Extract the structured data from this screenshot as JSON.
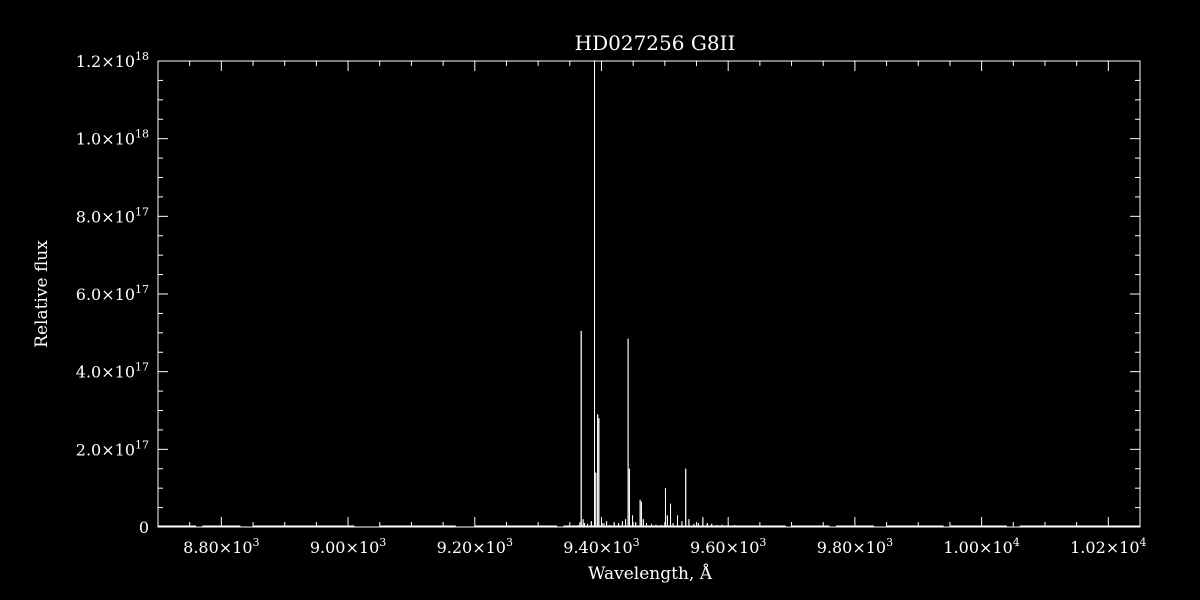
{
  "chart_data": {
    "type": "line",
    "title": "HD027256   G8II",
    "xlabel": "Wavelength, Å",
    "ylabel": "Relative flux",
    "xlim": [
      8700,
      10250
    ],
    "ylim": [
      0,
      1.2e+18
    ],
    "colors": {
      "background": "#000000",
      "foreground": "#ffffff"
    },
    "x_ticks": [
      {
        "value": 8800,
        "mant": "8.80",
        "exp": "3"
      },
      {
        "value": 9000,
        "mant": "9.00",
        "exp": "3"
      },
      {
        "value": 9200,
        "mant": "9.20",
        "exp": "3"
      },
      {
        "value": 9400,
        "mant": "9.40",
        "exp": "3"
      },
      {
        "value": 9600,
        "mant": "9.60",
        "exp": "3"
      },
      {
        "value": 9800,
        "mant": "9.80",
        "exp": "3"
      },
      {
        "value": 10000,
        "mant": "1.00",
        "exp": "4"
      },
      {
        "value": 10200,
        "mant": "1.02",
        "exp": "4"
      }
    ],
    "y_ticks": [
      {
        "value": 0,
        "mant": "0",
        "exp": ""
      },
      {
        "value": 2e+17,
        "mant": "2.0",
        "exp": "17"
      },
      {
        "value": 4e+17,
        "mant": "4.0",
        "exp": "17"
      },
      {
        "value": 6e+17,
        "mant": "6.0",
        "exp": "17"
      },
      {
        "value": 8e+17,
        "mant": "8.0",
        "exp": "17"
      },
      {
        "value": 1e+18,
        "mant": "1.0",
        "exp": "18"
      },
      {
        "value": 1.2e+18,
        "mant": "1.2",
        "exp": "18"
      }
    ],
    "times_symbol": "×10",
    "baseline_segments": [
      [
        8700,
        8760
      ],
      [
        8770,
        8830
      ],
      [
        8850,
        9010
      ],
      [
        9050,
        9170
      ],
      [
        9200,
        9330
      ],
      [
        9340,
        9370
      ]
    ],
    "series": [
      {
        "values": [
          [
            9350,
            2000000000000000.0
          ],
          [
            9355,
            4000000000000000.0
          ],
          [
            9363,
            5000000000000000.0
          ],
          [
            9366,
            1.2e+16
          ],
          [
            9368,
            5.05e+17
          ],
          [
            9371,
            2e+16
          ],
          [
            9373,
            1e+16
          ],
          [
            9378,
            8000000000000000.0
          ],
          [
            9384,
            1.5e+16
          ],
          [
            9389,
            1.2e+18
          ],
          [
            9391,
            1.4e+17
          ],
          [
            9394,
            2.9e+17
          ],
          [
            9396,
            2.8e+17
          ],
          [
            9401,
            1e+16
          ],
          [
            9404,
            1e+16
          ],
          [
            9408,
            1.5e+16
          ],
          [
            9413,
            5000000000000000.0
          ],
          [
            9420,
            1.2e+16
          ],
          [
            9427,
            1e+16
          ],
          [
            9433,
            1.5e+16
          ],
          [
            9438,
            2e+16
          ],
          [
            9442,
            4.85e+17
          ],
          [
            9444,
            1.5e+17
          ],
          [
            9449,
            3e+16
          ],
          [
            9454,
            1.2e+16
          ],
          [
            9461,
            7e+16
          ],
          [
            9463,
            6.5e+16
          ],
          [
            9466,
            2e+16
          ],
          [
            9471,
            1e+16
          ],
          [
            9479,
            8000000000000000.0
          ],
          [
            9486,
            6000000000000000.0
          ],
          [
            9494,
            5000000000000000.0
          ],
          [
            9501,
            1e+17
          ],
          [
            9504,
            3e+16
          ],
          [
            9509,
            6e+16
          ],
          [
            9513,
            1e+16
          ],
          [
            9520,
            3e+16
          ],
          [
            9527,
            1.5e+16
          ],
          [
            9533,
            1.5e+17
          ],
          [
            9538,
            2e+16
          ],
          [
            9546,
            8000000000000000.0
          ],
          [
            9553,
            1e+16
          ],
          [
            9560,
            2.5e+16
          ],
          [
            9567,
            1e+16
          ],
          [
            9574,
            8000000000000000.0
          ],
          [
            9582,
            5000000000000000.0
          ],
          [
            9590,
            6000000000000000.0
          ],
          [
            9600,
            5000000000000000.0
          ],
          [
            9610,
            5000000000000000.0
          ],
          [
            9620,
            3000000000000000.0
          ],
          [
            9630,
            3000000000000000.0
          ],
          [
            9640,
            3000000000000000.0
          ],
          [
            9650,
            2000000000000000.0
          ],
          [
            9660,
            2000000000000000.0
          ],
          [
            9670,
            1000000000000000.0
          ],
          [
            9680,
            1000000000000000.0
          ],
          [
            9690,
            1000000000000000.0
          ]
        ]
      }
    ],
    "tail_segments": [
      [
        9700,
        9760
      ],
      [
        9770,
        9830
      ],
      [
        9850,
        9940
      ],
      [
        9950,
        10040
      ],
      [
        10060,
        10250
      ]
    ]
  }
}
